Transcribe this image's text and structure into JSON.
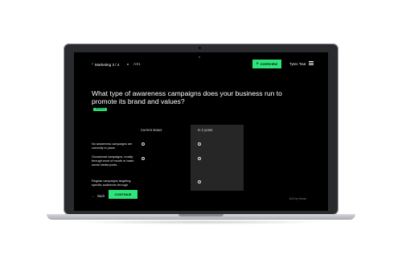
{
  "header": {
    "breadcrumb": "Marketing 3 / 4",
    "section_code": "AX1",
    "overview_label": "OVERVIEW",
    "user_name": "Tyrec Tout"
  },
  "question": {
    "text": "What type of awareness campaigns does your business run to promote its brand and values?",
    "tag": "Marketing"
  },
  "columns": [
    "Current status",
    "In 2 years"
  ],
  "rows": [
    "No awareness campaigns are currently in place.",
    "Occasional campaigns, mostly through word of mouth or basic social media posts.",
    "Regular campaigns targeting specific audiences through"
  ],
  "footer": {
    "back_label": "Back",
    "continue_label": "CONTINUE",
    "note": "AX1 by Hoxar"
  },
  "colors": {
    "accent": "#2ee57a",
    "background": "#000000"
  }
}
